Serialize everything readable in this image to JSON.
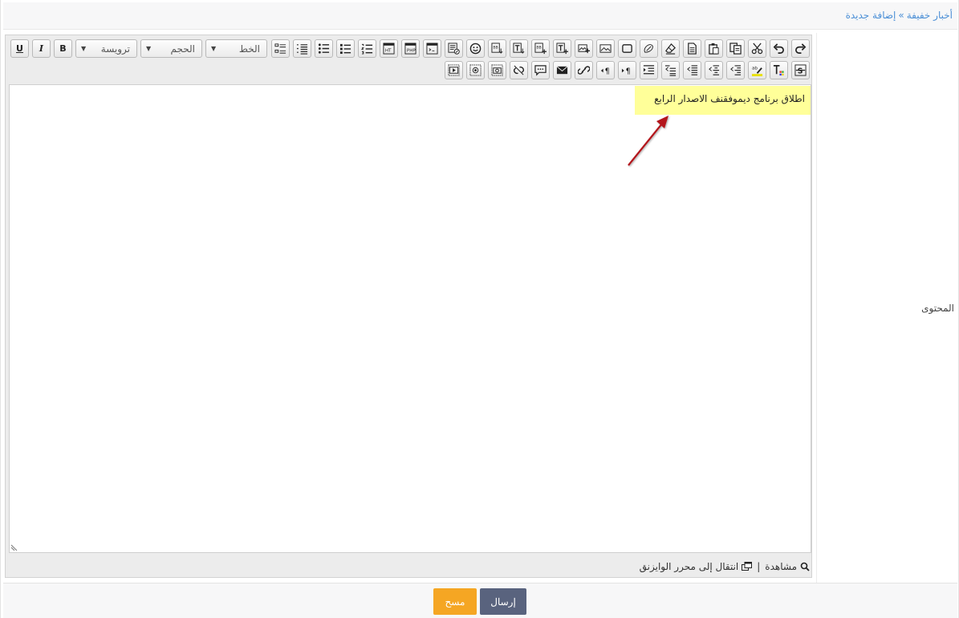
{
  "breadcrumb": {
    "parent": "أخبار خفيفة",
    "separator": "»",
    "current": "إضافة جديدة"
  },
  "form": {
    "content_label": "المحتوى"
  },
  "toolbar": {
    "selects": {
      "format": "ترويسة",
      "size": "الحجم",
      "font": "الخط"
    },
    "buttons": {
      "underline": "U",
      "italic": "I",
      "bold": "B"
    }
  },
  "editor": {
    "content_text": "اطلاق برنامج ديموفقنف الاصدار الرابع",
    "highlight_color": "#ffff99"
  },
  "footer": {
    "preview_label": "مشاهدة",
    "wysiwyg_label": "انتقال إلى محرر الوايزنق"
  },
  "actions": {
    "submit_label": "إرسال",
    "clear_label": "مسح"
  },
  "colors": {
    "link": "#4b8fd6",
    "submit_bg": "#59637e",
    "clear_bg": "#f5a623",
    "arrow": "#b3181e"
  }
}
